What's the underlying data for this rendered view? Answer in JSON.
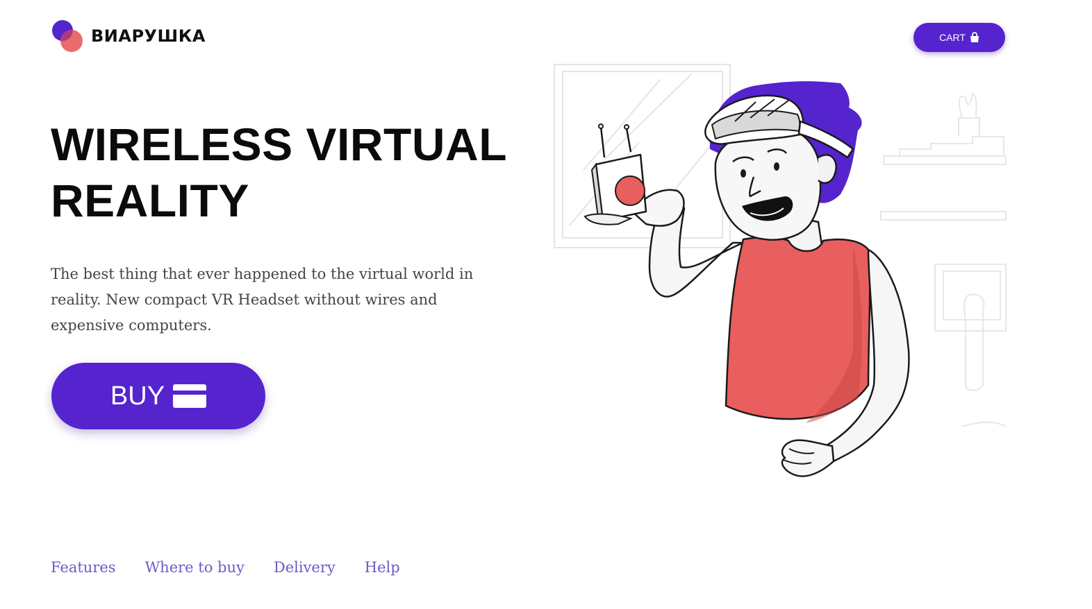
{
  "brand": {
    "name": "ВИАРУШКА",
    "colors": {
      "primary": "#5524cf",
      "accent": "#e95e5e"
    }
  },
  "header": {
    "cart_label": "CART",
    "cart_icon": "shopping-bag-icon"
  },
  "hero": {
    "title_line1": "WIRELESS VIRTUAL",
    "title_line2": "REALITY",
    "description": "The best thing that ever happened to the virtual world in reality. New compact VR Headset without wires and expensive computers.",
    "buy_label": "BUY",
    "buy_icon": "credit-card-icon"
  },
  "footer": {
    "nav": [
      {
        "label": "Features"
      },
      {
        "label": "Where to buy"
      },
      {
        "label": "Delivery"
      },
      {
        "label": "Help"
      }
    ]
  }
}
